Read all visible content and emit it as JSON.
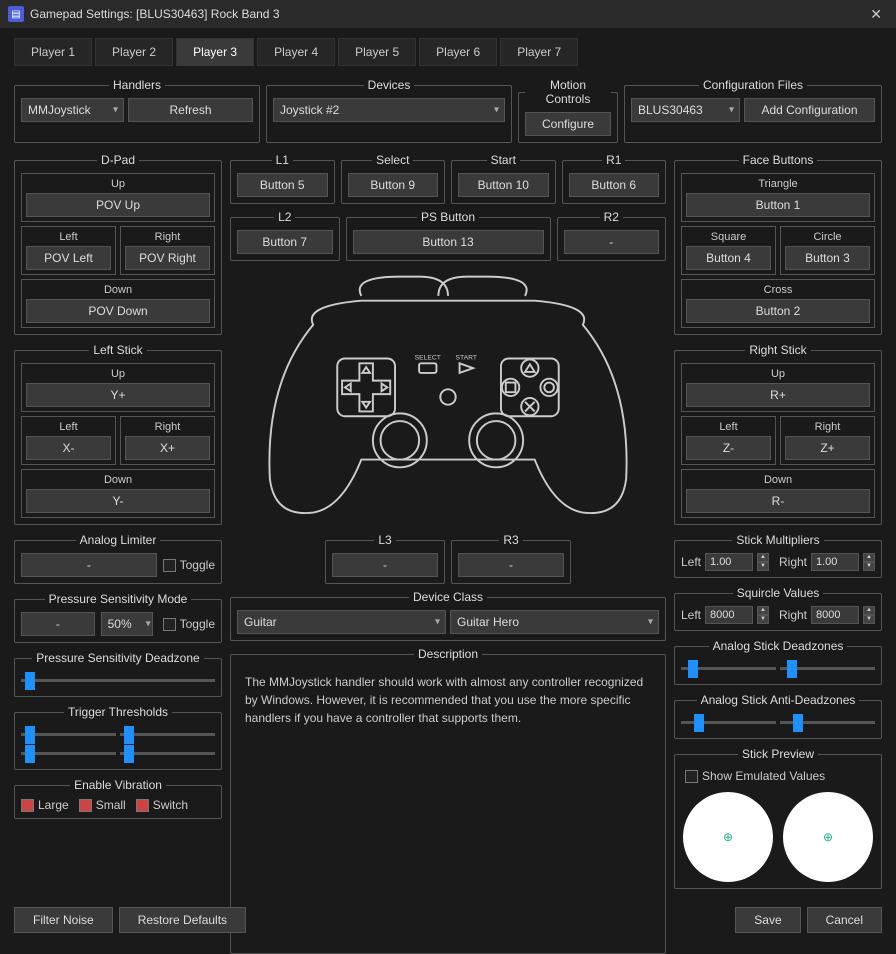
{
  "window": {
    "title": "Gamepad Settings: [BLUS30463] Rock Band 3"
  },
  "tabs": [
    "Player 1",
    "Player 2",
    "Player 3",
    "Player 4",
    "Player 5",
    "Player 6",
    "Player 7"
  ],
  "active_tab": 2,
  "handlers": {
    "legend": "Handlers",
    "value": "MMJoystick",
    "refresh": "Refresh"
  },
  "devices": {
    "legend": "Devices",
    "value": "Joystick #2"
  },
  "motion": {
    "legend": "Motion Controls",
    "configure": "Configure"
  },
  "config": {
    "legend": "Configuration Files",
    "value": "BLUS30463",
    "add": "Add Configuration"
  },
  "dpad": {
    "legend": "D-Pad",
    "up_l": "Up",
    "up": "POV Up",
    "left_l": "Left",
    "left": "POV Left",
    "right_l": "Right",
    "right": "POV Right",
    "down_l": "Down",
    "down": "POV Down"
  },
  "l1": {
    "legend": "L1",
    "val": "Button 5"
  },
  "l2": {
    "legend": "L2",
    "val": "Button 7"
  },
  "select": {
    "legend": "Select",
    "val": "Button 9"
  },
  "start": {
    "legend": "Start",
    "val": "Button 10"
  },
  "r1": {
    "legend": "R1",
    "val": "Button 6"
  },
  "r2": {
    "legend": "R2",
    "val": "-"
  },
  "ps": {
    "legend": "PS Button",
    "val": "Button 13"
  },
  "face": {
    "legend": "Face Buttons",
    "tri_l": "Triangle",
    "tri": "Button 1",
    "sq_l": "Square",
    "sq": "Button 4",
    "ci_l": "Circle",
    "ci": "Button 3",
    "cr_l": "Cross",
    "cr": "Button 2"
  },
  "lstick": {
    "legend": "Left Stick",
    "up_l": "Up",
    "up": "Y+",
    "left_l": "Left",
    "left": "X-",
    "right_l": "Right",
    "right": "X+",
    "down_l": "Down",
    "down": "Y-"
  },
  "rstick": {
    "legend": "Right Stick",
    "up_l": "Up",
    "up": "R+",
    "left_l": "Left",
    "left": "Z-",
    "right_l": "Right",
    "right": "Z+",
    "down_l": "Down",
    "down": "R-"
  },
  "l3": {
    "legend": "L3",
    "val": "-"
  },
  "r3": {
    "legend": "R3",
    "val": "-"
  },
  "device_class": {
    "legend": "Device Class",
    "a": "Guitar",
    "b": "Guitar Hero"
  },
  "description": {
    "legend": "Description",
    "text": "The MMJoystick handler should work with almost any controller recognized by Windows. However, it is recommended that you use the more specific handlers if you have a controller that supports them."
  },
  "analog_limiter": {
    "legend": "Analog Limiter",
    "val": "-",
    "toggle": "Toggle"
  },
  "pressure_mode": {
    "legend": "Pressure Sensitivity Mode",
    "val": "-",
    "pct": "50%",
    "toggle": "Toggle"
  },
  "pressure_dead": {
    "legend": "Pressure Sensitivity Deadzone"
  },
  "trigger_thresh": {
    "legend": "Trigger Thresholds"
  },
  "vibration": {
    "legend": "Enable Vibration",
    "large": "Large",
    "small": "Small",
    "switch": "Switch"
  },
  "stick_mult": {
    "legend": "Stick Multipliers",
    "left_l": "Left",
    "left": "1.00",
    "right_l": "Right",
    "right": "1.00"
  },
  "squircle": {
    "legend": "Squircle Values",
    "left_l": "Left",
    "left": "8000",
    "right_l": "Right",
    "right": "8000"
  },
  "analog_dead": {
    "legend": "Analog Stick Deadzones"
  },
  "analog_antidead": {
    "legend": "Analog Stick Anti-Deadzones"
  },
  "stick_preview": {
    "legend": "Stick Preview",
    "show": "Show Emulated Values"
  },
  "footer": {
    "filter": "Filter Noise",
    "restore": "Restore Defaults",
    "save": "Save",
    "cancel": "Cancel"
  }
}
